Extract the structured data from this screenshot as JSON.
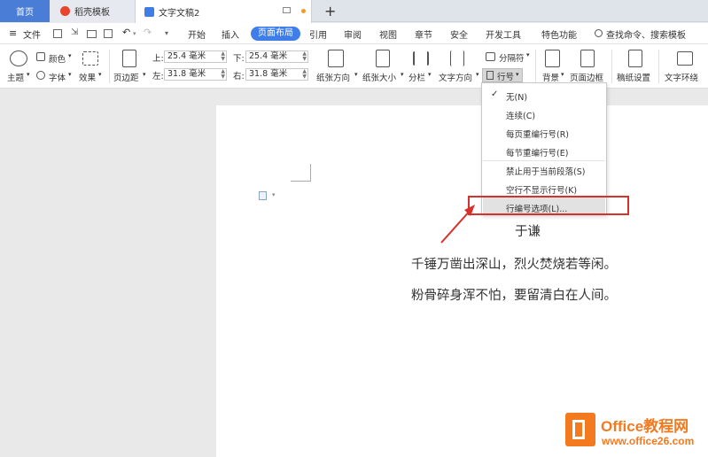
{
  "tabs": {
    "home": "首页",
    "template": "稻壳模板",
    "document": "文字文稿2",
    "new_tab": "+"
  },
  "menubar": {
    "file": "文件",
    "items": [
      "开始",
      "插入",
      "页面布局",
      "引用",
      "审阅",
      "视图",
      "章节",
      "安全",
      "开发工具",
      "特色功能"
    ],
    "active": "页面布局",
    "search": "查找命令、搜索模板"
  },
  "ribbon": {
    "theme": "主题",
    "color": "颜色",
    "font": "字体",
    "effect": "效果",
    "margins": "页边距",
    "top_label": "上:",
    "top_value": "25.4 毫米",
    "bottom_label": "下:",
    "bottom_value": "25.4 毫米",
    "left_label": "左:",
    "left_value": "31.8 毫米",
    "right_label": "右:",
    "right_value": "31.8 毫米",
    "orientation": "纸张方向",
    "size": "纸张大小",
    "columns": "分栏",
    "text_direction": "文字方向",
    "breaks": "分隔符",
    "line_numbers": "行号",
    "background": "背景",
    "page_border": "页面边框",
    "draft_paper": "稿纸设置",
    "text_wrap": "文字环绕"
  },
  "line_number_menu": {
    "items": [
      {
        "label": "无(N)",
        "checked": true
      },
      {
        "label": "连续(C)"
      },
      {
        "label": "每页重编行号(R)"
      },
      {
        "label": "每节重编行号(E)"
      },
      {
        "label": "禁止用于当前段落(S)"
      },
      {
        "label": "空行不显示行号(K)"
      },
      {
        "label": "行编号选项(L)..."
      }
    ]
  },
  "document": {
    "author": "于谦",
    "line1": "千锤万凿出深山，烈火焚烧若等闲。",
    "line2": "粉骨碎身浑不怕，要留清白在人间。"
  },
  "watermark": {
    "brand": "Office教程网",
    "url": "www.office26.com"
  },
  "colors": {
    "accent": "#3f7ee8",
    "highlight": "#d8312b",
    "watermark_orange": "#f47a20"
  }
}
